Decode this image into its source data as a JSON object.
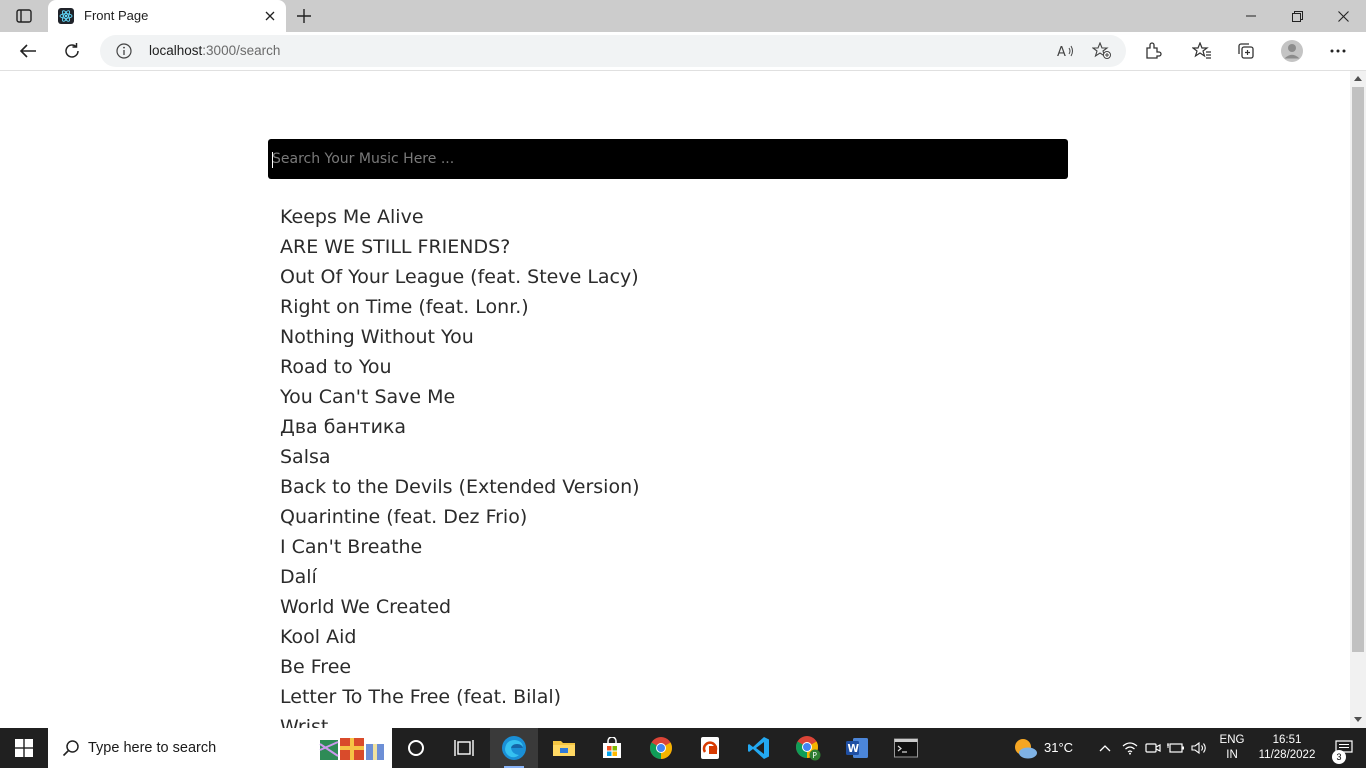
{
  "browser": {
    "tab_title": "Front Page",
    "url_host": "localhost",
    "url_port_path": ":3000/search"
  },
  "search": {
    "placeholder": "Search Your Music Here ...",
    "value": ""
  },
  "results": [
    "Keeps Me Alive",
    "ARE WE STILL FRIENDS?",
    "Out Of Your League (feat. Steve Lacy)",
    "Right on Time (feat. Lonr.)",
    "Nothing Without You",
    "Road to You",
    "You Can't Save Me",
    "Два бантика",
    "Salsa",
    "Back to the Devils (Extended Version)",
    "Quarintine (feat. Dez Frio)",
    "I Can't Breathe",
    "Dalí",
    "World We Created",
    "Kool Aid",
    "Be Free",
    "Letter To The Free (feat. Bilal)",
    "Wrist"
  ],
  "taskbar": {
    "search_text": "Type here to search",
    "temperature": "31°C",
    "lang_line1": "ENG",
    "lang_line2": "IN",
    "time": "16:51",
    "date": "11/28/2022",
    "notification_count": "3"
  },
  "colors": {
    "search_bg": "#000000",
    "tabstrip_bg": "#cccccc",
    "taskbar_bg": "#202020"
  }
}
